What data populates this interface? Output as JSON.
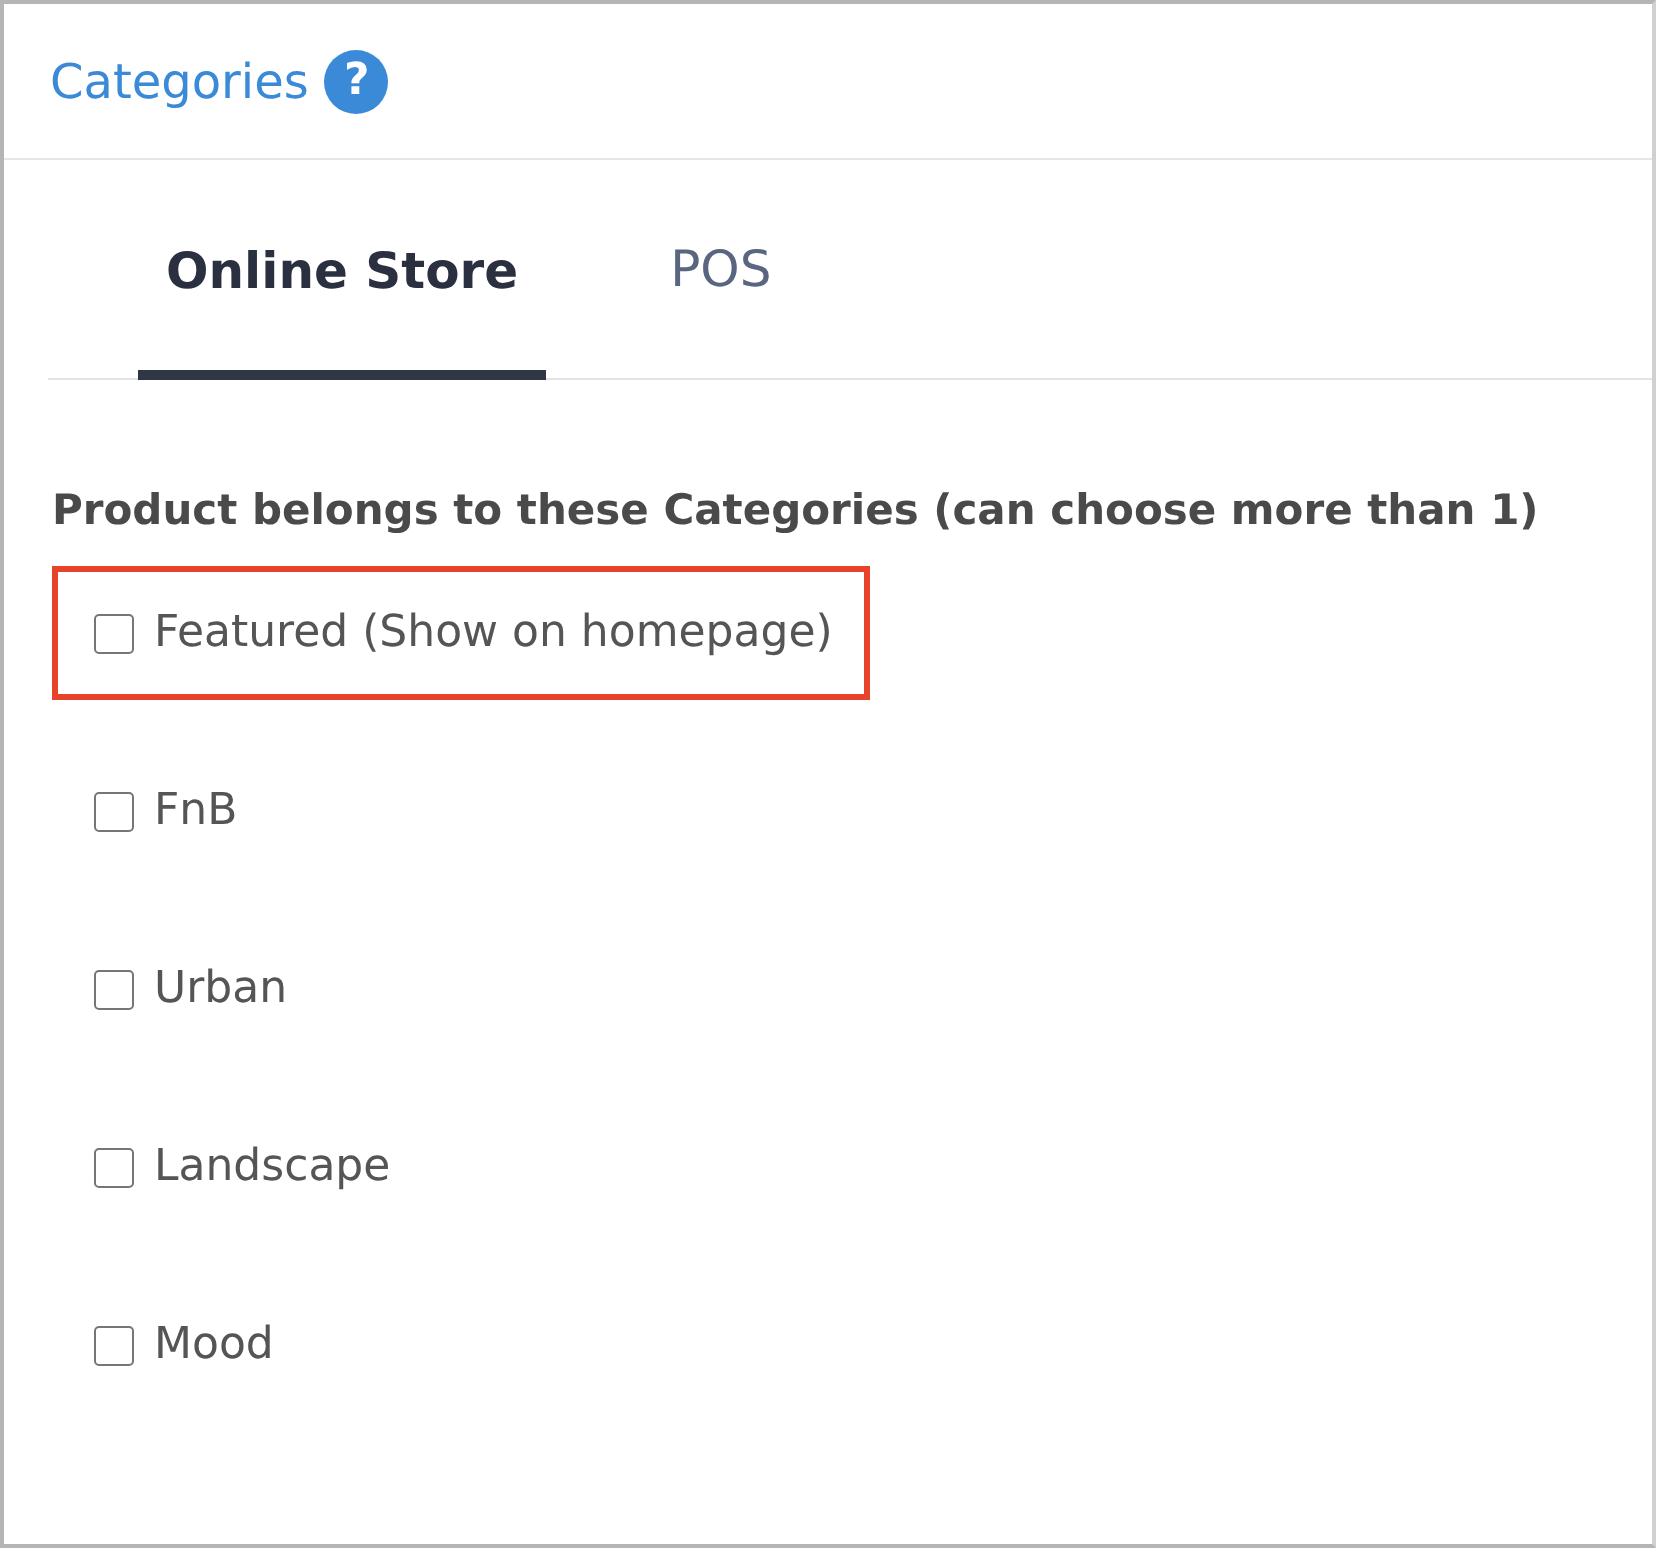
{
  "panel": {
    "title": "Categories",
    "help_icon": "?"
  },
  "tabs": [
    {
      "label": "Online Store",
      "selected": true
    },
    {
      "label": "POS",
      "selected": false
    }
  ],
  "heading": "Product belongs to these Categories (can choose more than 1)",
  "categories": [
    {
      "label": "Featured (Show on homepage)",
      "checked": false,
      "highlighted": true
    },
    {
      "label": "FnB",
      "checked": false,
      "highlighted": false
    },
    {
      "label": "Urban",
      "checked": false,
      "highlighted": false
    },
    {
      "label": "Landscape",
      "checked": false,
      "highlighted": false
    },
    {
      "label": "Mood",
      "checked": false,
      "highlighted": false
    }
  ]
}
